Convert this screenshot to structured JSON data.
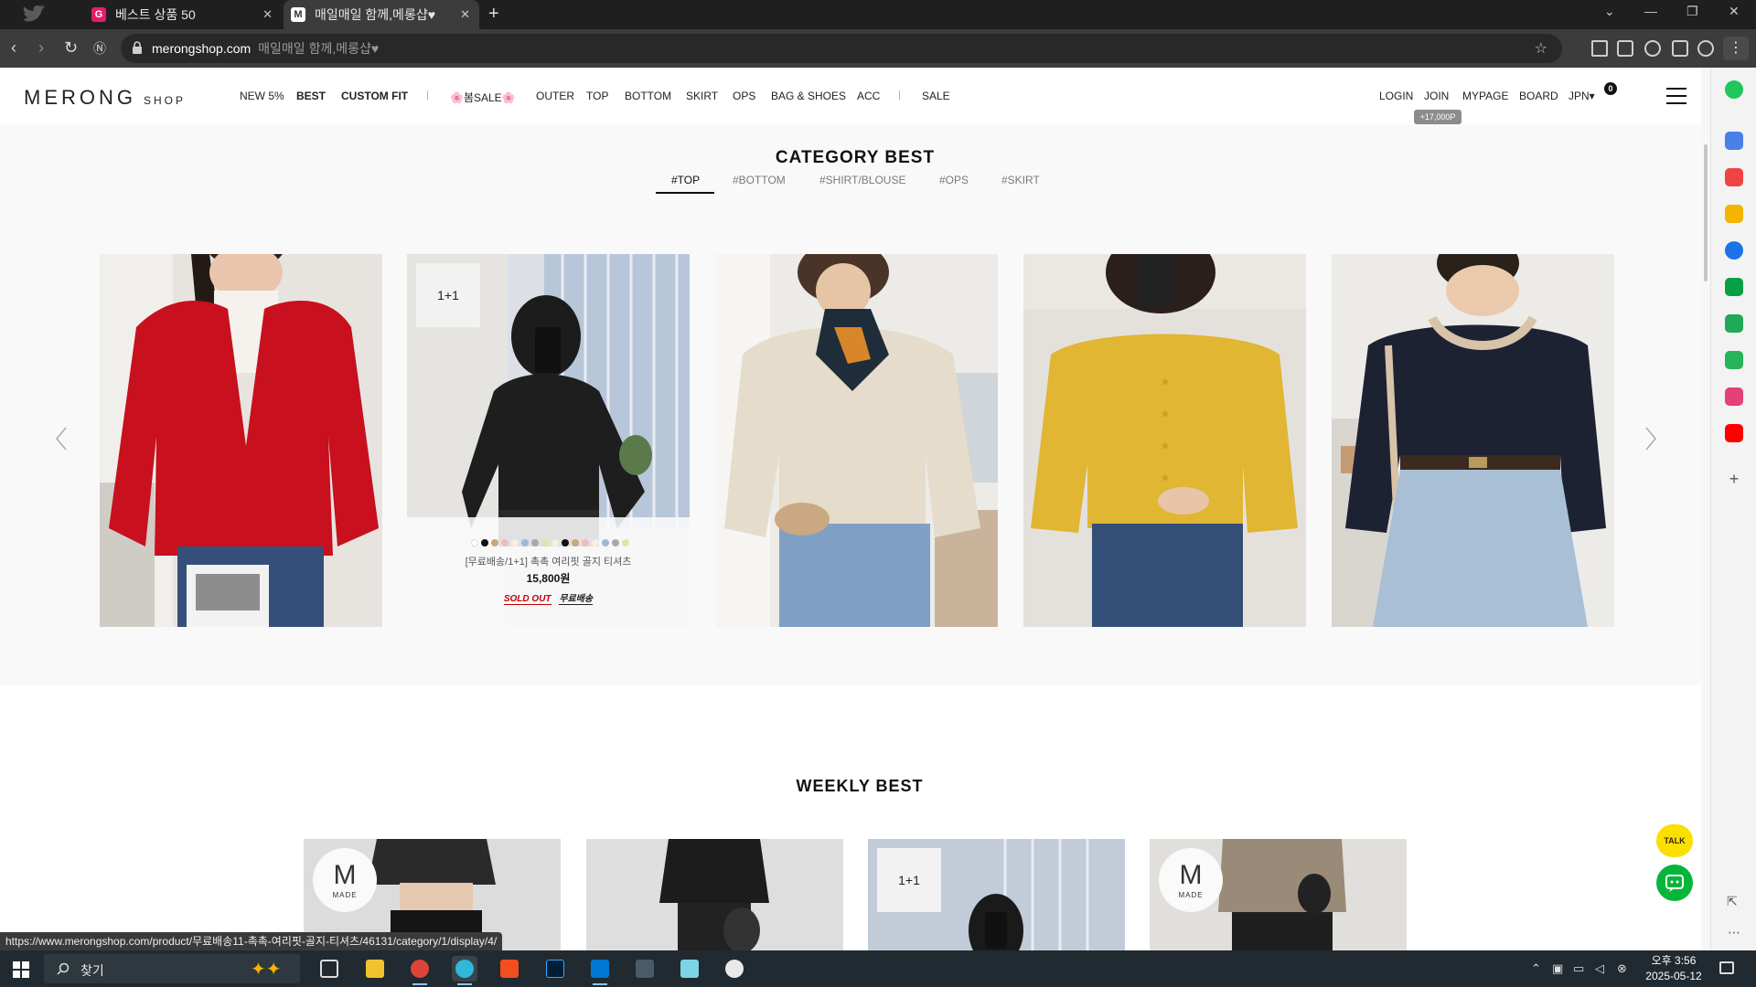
{
  "browser": {
    "tabs": [
      {
        "label": "베스트 상품 50",
        "favicon": "G",
        "active": false
      },
      {
        "label": "매일매일 함께,메롱샵♥",
        "favicon": "M",
        "active": true
      }
    ],
    "new_tab": "+",
    "url": "merongshop.com",
    "page_title_hint": "매일매일 함께,메롱샵♥",
    "status_url": "https://www.merongshop.com/product/무료배송11-촉촉-여리핏-골지-티셔츠/46131/category/1/display/4/"
  },
  "site": {
    "logo_main": "MERONG",
    "logo_sub": "SHOP",
    "nav": [
      "NEW 5%",
      "BEST",
      "CUSTOM FIT",
      "|",
      "🌸봄SALE🌸",
      "OUTER",
      "TOP",
      "BOTTOM",
      "SKIRT",
      "OPS",
      "BAG & SHOES",
      "ACC",
      "|",
      "SALE"
    ],
    "util": [
      "LOGIN",
      "JOIN",
      "MYPAGE",
      "BOARD",
      "JPN▾"
    ],
    "point_badge": "+17,000P",
    "cart_count": "0"
  },
  "category_best": {
    "title": "CATEGORY BEST",
    "tabs": [
      "#TOP",
      "#BOTTOM",
      "#SHIRT/BLOUSE",
      "#OPS",
      "#SKIRT"
    ],
    "active_tab": "#TOP",
    "products": [
      {
        "badge": "",
        "color": "red-cardigan"
      },
      {
        "badge": "1+1",
        "name": "[무료배송/1+1] 촉촉 여리핏 골지 티셔츠",
        "price": "15,800원",
        "tag_soldout": "SOLD OUT",
        "tag_shipping": "무료배송",
        "hover": true
      },
      {
        "badge": "",
        "color": "beige-blouse"
      },
      {
        "badge": "",
        "color": "yellow-cardigan"
      },
      {
        "badge": "",
        "color": "navy-knit"
      }
    ]
  },
  "weekly_best": {
    "title": "WEEKLY BEST",
    "products": [
      {
        "badge": "MADE"
      },
      {
        "badge": ""
      },
      {
        "badge": "1+1"
      },
      {
        "badge": "MADE"
      }
    ]
  },
  "floating": {
    "kakao": "TALK"
  },
  "taskbar": {
    "search_label": "찾기",
    "clock_time": "오후 3:56",
    "clock_date": "2025-05-12"
  }
}
